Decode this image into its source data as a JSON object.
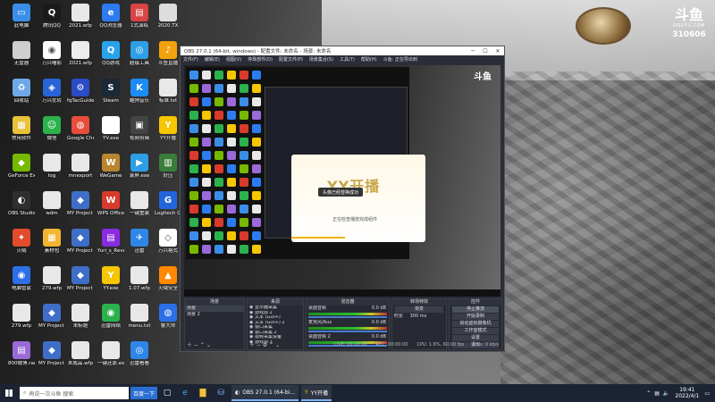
{
  "desktop": {
    "icons": [
      {
        "label": "此电脑",
        "color": "#3b8ee8",
        "glyph": "▭"
      },
      {
        "label": "腾讯QQ",
        "color": "#1a1a1a",
        "glyph": "Q"
      },
      {
        "label": "2021.wfp",
        "color": "#e8e8e8",
        "glyph": ""
      },
      {
        "label": "QQ浏览器",
        "color": "#2d7bf0",
        "glyph": "e"
      },
      {
        "label": "1式演练",
        "color": "#d94444",
        "glyph": "▤"
      },
      {
        "label": "2020.TX",
        "color": "#dddddd",
        "glyph": ""
      },
      {
        "label": "无盘器",
        "color": "#cfcfcf",
        "glyph": ""
      },
      {
        "label": "万兴喵影",
        "color": "#ffffff",
        "glyph": "◉"
      },
      {
        "label": "2021.wfp",
        "color": "#ececec",
        "glyph": ""
      },
      {
        "label": "QQ游戏",
        "color": "#29a3ea",
        "glyph": "Q"
      },
      {
        "label": "超级工具",
        "color": "#2e9fe6",
        "glyph": "◎"
      },
      {
        "label": "斗鱼直播",
        "color": "#f2a20c",
        "glyph": "♪"
      },
      {
        "label": "回收站",
        "color": "#6fa8e8",
        "glyph": "♻"
      },
      {
        "label": "万兴优转",
        "color": "#2864d8",
        "glyph": "◈"
      },
      {
        "label": "fqTacGuide",
        "color": "#2b4cc6",
        "glyph": "⚙"
      },
      {
        "label": "Steam",
        "color": "#1b2838",
        "glyph": "S"
      },
      {
        "label": "酷狗音乐",
        "color": "#1c8df5",
        "glyph": "K"
      },
      {
        "label": "标准.txt",
        "color": "#e8e8e8",
        "glyph": ""
      },
      {
        "label": "常用软件",
        "color": "#e8c23a",
        "glyph": "▦"
      },
      {
        "label": "微信",
        "color": "#2bb24c",
        "glyph": "☺"
      },
      {
        "label": "Google Chrome",
        "color": "#e84d3c",
        "glyph": "◍"
      },
      {
        "label": "YV.exe",
        "color": "#ffffff",
        "glyph": ""
      },
      {
        "label": "视频剪辑",
        "color": "#444444",
        "glyph": "▣"
      },
      {
        "label": "YY开播",
        "color": "#f6c600",
        "glyph": "Y"
      },
      {
        "label": "GeForce Experience",
        "color": "#76b900",
        "glyph": "◆"
      },
      {
        "label": "log",
        "color": "#e8e8e8",
        "glyph": ""
      },
      {
        "label": "mnexport",
        "color": "#e8e8e8",
        "glyph": ""
      },
      {
        "label": "WeGame",
        "color": "#b8862e",
        "glyph": "W"
      },
      {
        "label": "录屏.exe",
        "color": "#2e9fe6",
        "glyph": "▶"
      },
      {
        "label": "好压",
        "color": "#3a7d3a",
        "glyph": "▥"
      },
      {
        "label": "OBS Studio",
        "color": "#302e31",
        "glyph": "◐"
      },
      {
        "label": "wdm",
        "color": "#e8e8e8",
        "glyph": ""
      },
      {
        "label": "MY Project 1.wfp",
        "color": "#3e6ec7",
        "glyph": "◆"
      },
      {
        "label": "WPS Office",
        "color": "#d83b2b",
        "glyph": "W"
      },
      {
        "label": "一键重装",
        "color": "#e8e8e8",
        "glyph": ""
      },
      {
        "label": "Logitech G HUB",
        "color": "#2266dd",
        "glyph": "G"
      },
      {
        "label": "火绒",
        "color": "#e24b2b",
        "glyph": "✦"
      },
      {
        "label": "素材包",
        "color": "#f2b632",
        "glyph": "▦"
      },
      {
        "label": "MY Project 2.wfp",
        "color": "#3e6ec7",
        "glyph": "◆"
      },
      {
        "label": "Yuri_s_Revenge",
        "color": "#8a2be2",
        "glyph": "▤"
      },
      {
        "label": "迅雷",
        "color": "#2d86e8",
        "glyph": "✈"
      },
      {
        "label": "万兴格式",
        "color": "#ffffff",
        "glyph": "◇"
      },
      {
        "label": "电脑管家",
        "color": "#2b70e8",
        "glyph": "◉"
      },
      {
        "label": "279.wfp",
        "color": "#e8e8e8",
        "glyph": ""
      },
      {
        "label": "MY Project 2.wfp",
        "color": "#3e6ec7",
        "glyph": "◆"
      },
      {
        "label": "YY.exe",
        "color": "#f6c600",
        "glyph": "Y"
      },
      {
        "label": "1.07.wfp",
        "color": "#e8e8e8",
        "glyph": ""
      },
      {
        "label": "火绒安全",
        "color": "#ff8800",
        "glyph": "▲"
      },
      {
        "label": "279.wfp",
        "color": "#e8e8e8",
        "glyph": ""
      },
      {
        "label": "MY Project 3.wfp",
        "color": "#3e6ec7",
        "glyph": "◆"
      },
      {
        "label": "未标题",
        "color": "#e8e8e8",
        "glyph": ""
      },
      {
        "label": "迅雷网络",
        "color": "#2bb24c",
        "glyph": "◉"
      },
      {
        "label": "menu.txt",
        "color": "#e8e8e8",
        "glyph": ""
      },
      {
        "label": "鲁大师",
        "color": "#2b70e8",
        "glyph": "◍"
      },
      {
        "label": "800微博.rar",
        "color": "#9a6ad8",
        "glyph": "▤"
      },
      {
        "label": "MY Project 5.wfp",
        "color": "#3e6ec7",
        "glyph": "◆"
      },
      {
        "label": "未成品.wfp",
        "color": "#e8e8e8",
        "glyph": ""
      },
      {
        "label": "一键还原.exe",
        "color": "#e8e8e8",
        "glyph": ""
      },
      {
        "label": "迅雷看看",
        "color": "#2d86e8",
        "glyph": "◎"
      }
    ],
    "logo": {
      "text": "斗鱼",
      "sub": "DOUYU.COM",
      "room": "310606"
    }
  },
  "obs": {
    "title": "OBS 27.0.1 (64-bit, windows) - 配置文件: 未命名 - 场景: 未命名",
    "menu": [
      "文件(F)",
      "编辑(E)",
      "视图(V)",
      "停靠部件(D)",
      "配置文件(P)",
      "场景集合(S)",
      "工具(T)",
      "帮助(H)",
      "斗鱼: 正在导出到"
    ],
    "yy": {
      "brand": "YY开播",
      "toast": "头像已经替换成功",
      "status": "正在检查播放完成组件"
    },
    "scenes_header": "场景",
    "scenes": [
      "场景",
      "场景 2"
    ],
    "sources_header": "来源",
    "sources": [
      "显示器采集",
      "游戏源 2",
      "文本 (GDI+)",
      "文本 (GDI+) 2",
      "窗口采集",
      "窗口采集 2",
      "视频采集设备",
      "游戏源 3"
    ],
    "mixer_header": "混音器",
    "mixer": [
      {
        "name": "桌面音频",
        "level": "0.0 dB"
      },
      {
        "name": "麦克风/Aux",
        "level": "0.0 dB"
      },
      {
        "name": "桌面音频 2",
        "level": "0.0 dB"
      }
    ],
    "transitions_header": "转场特效",
    "transition": "渐变",
    "duration_label": "时长",
    "duration": "300 ms",
    "controls_header": "控件",
    "controls": [
      "停止推流",
      "开始录制",
      "启动虚拟摄像机",
      "工作室模式",
      "设置",
      "退出"
    ],
    "status": {
      "live": "LIVE: 00:00:00",
      "rec": "REC: 00:00:00",
      "cpu": "CPU: 1.6%, 60.00 fps",
      "kb": "kb/s: 0 kb/s"
    }
  },
  "taskbar": {
    "search_placeholder": "再说一次斗鱼 搜索",
    "search_button": "百度一下",
    "tasks": [
      "OBS 27.0.1 (64-bi...",
      "YY开播"
    ],
    "time": "19:41",
    "date": "2022/4/1"
  }
}
